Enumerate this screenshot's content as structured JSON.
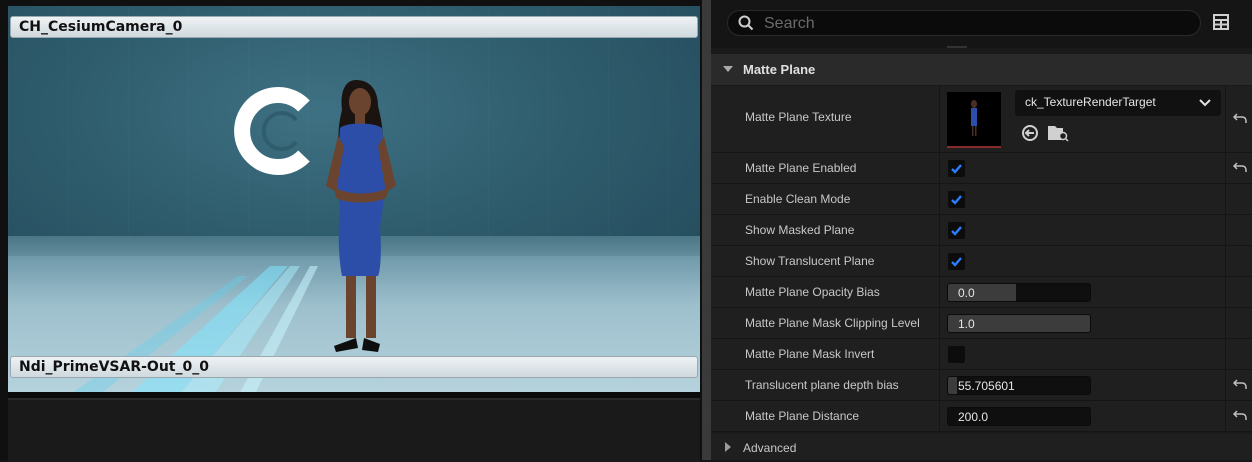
{
  "viewport": {
    "top_overlay_title": "CH_CesiumCamera_0",
    "bottom_overlay_title": "Ndi_PrimeVSAR-Out_0_0"
  },
  "details": {
    "search": {
      "placeholder": "Search",
      "value": ""
    },
    "section": {
      "title": "Matte Plane",
      "expanded": true
    },
    "texture_row": {
      "label": "Matte Plane Texture",
      "asset_name": "ck_TextureRenderTarget",
      "icons": [
        "use-selected-icon",
        "browse-to-asset-icon",
        "reset-to-default-icon"
      ]
    },
    "rows": [
      {
        "label": "Matte Plane Enabled",
        "type": "checkbox",
        "checked": true,
        "reset": true
      },
      {
        "label": "Enable Clean Mode",
        "type": "checkbox",
        "checked": true,
        "reset": false
      },
      {
        "label": "Show Masked Plane",
        "type": "checkbox",
        "checked": true,
        "reset": false
      },
      {
        "label": "Show Translucent Plane",
        "type": "checkbox",
        "checked": true,
        "reset": false
      },
      {
        "label": "Matte Plane Opacity Bias",
        "type": "number",
        "value": "0.0",
        "fill": 0.48,
        "reset": false
      },
      {
        "label": "Matte Plane Mask Clipping Level",
        "type": "number",
        "value": "1.0",
        "fill": 1.0,
        "reset": false
      },
      {
        "label": "Matte Plane Mask Invert",
        "type": "checkbox",
        "checked": false,
        "reset": false
      },
      {
        "label": "Translucent plane depth bias",
        "type": "number",
        "value": "55.705601",
        "fill": 0.06,
        "reset": true
      },
      {
        "label": "Matte Plane Distance",
        "type": "number",
        "value": "200.0",
        "fill": 0,
        "reset": true
      }
    ],
    "advanced": {
      "label": "Advanced",
      "expanded": false
    }
  },
  "colors": {
    "checkbox_check": "#2a7fff",
    "panel_bg": "#1a1a1a",
    "row_bg": "#1f1f1f"
  }
}
